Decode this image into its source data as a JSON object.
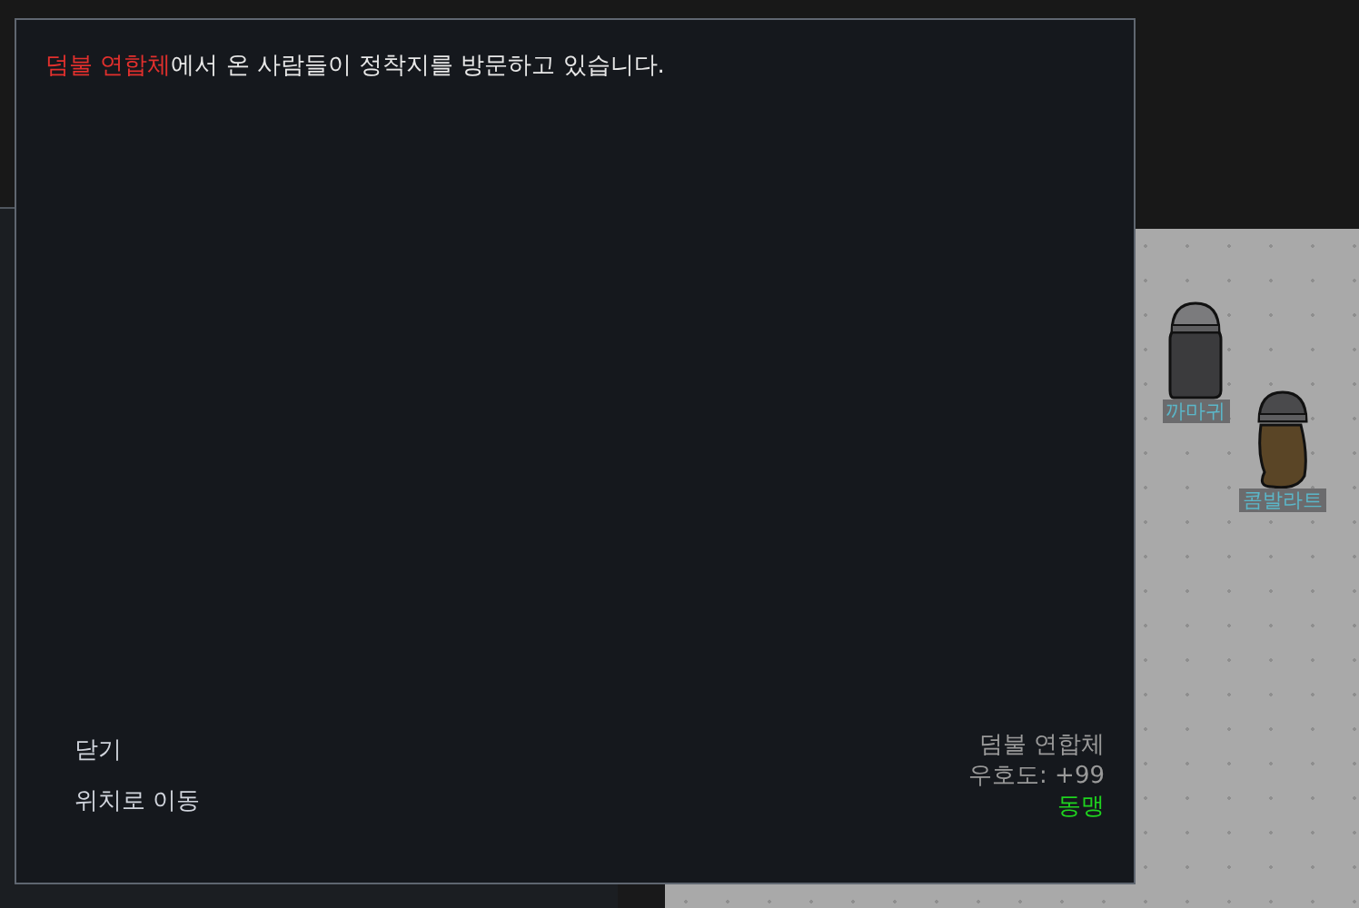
{
  "message": {
    "faction": "덤불 연합체",
    "text": "에서 온 사람들이 정착지를 방문하고 있습니다."
  },
  "options": [
    {
      "label": "닫기"
    },
    {
      "label": "위치로 이동"
    }
  ],
  "faction_info": {
    "name": "덤불 연합체",
    "goodwill": "우호도: +99",
    "relation": "동맹"
  },
  "pawns": [
    {
      "name": "까마귀",
      "kind": "dark"
    },
    {
      "name": "콤발라트",
      "kind": "brown"
    }
  ]
}
